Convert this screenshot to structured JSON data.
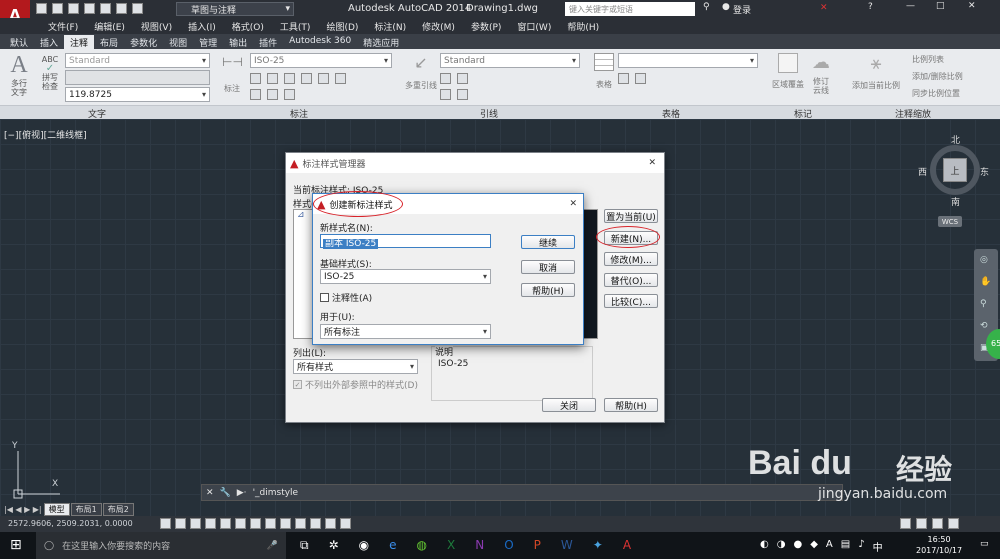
{
  "titlebar": {
    "workspace": "草图与注释",
    "app_title": "Autodesk AutoCAD 2014",
    "file": "Drawing1.dwg",
    "search_placeholder": "键入关键字或短语",
    "login": "登录"
  },
  "menu": [
    "文件(F)",
    "编辑(E)",
    "视图(V)",
    "插入(I)",
    "格式(O)",
    "工具(T)",
    "绘图(D)",
    "标注(N)",
    "修改(M)",
    "参数(P)",
    "窗口(W)",
    "帮助(H)"
  ],
  "ribbon_tabs": [
    "默认",
    "插入",
    "注释",
    "布局",
    "参数化",
    "视图",
    "管理",
    "输出",
    "插件",
    "Autodesk 360",
    "精选应用"
  ],
  "active_tab": "注释",
  "ribbon": {
    "text": {
      "multiline": "多行\n文字",
      "spell": "拼写\n检查",
      "style": "Standard",
      "height": "119.8725",
      "panel": "文字"
    },
    "dim": {
      "label": "标注",
      "style": "ISO-25",
      "panel": "标注"
    },
    "leader": {
      "label": "多重引线",
      "style": "Standard",
      "panel": "引线"
    },
    "table": {
      "label": "表格",
      "panel": "表格"
    },
    "markup": {
      "region": "区域覆盖",
      "revcloud": "修订\n云线",
      "panel": "标记"
    },
    "scale": {
      "add_current": "添加当前比例",
      "scale_list": "比例列表",
      "add_delete": "添加/删除比例",
      "sync": "同步比例位置",
      "panel": "注释缩放"
    }
  },
  "viewport_label": "[−][俯视][二维线框]",
  "viewcube": {
    "north": "北",
    "south": "南",
    "east": "东",
    "west": "西",
    "top": "上",
    "wcs": "WCS"
  },
  "ucs": {
    "x": "X",
    "y": "Y"
  },
  "cmdline": "'_dimstyle",
  "layout_tabs": [
    "模型",
    "布局1",
    "布局2"
  ],
  "coords": "2572.9606, 2509.2031, 0.0000",
  "dimstyle_dialog": {
    "title": "标注样式管理器",
    "current_label": "当前标注样式: ISO-25",
    "styles_label": "样式(S):",
    "list_label": "列出(L):",
    "list_value": "所有样式",
    "no_external": "不列出外部参照中的样式(D)",
    "desc_label": "说明",
    "desc_value": "ISO-25",
    "buttons": {
      "set_current": "置为当前(U)",
      "new": "新建(N)...",
      "modify": "修改(M)...",
      "override": "替代(O)...",
      "compare": "比较(C)...",
      "close": "关闭",
      "help": "帮助(H)"
    }
  },
  "new_dialog": {
    "title": "创建新标注样式",
    "name_label": "新样式名(N):",
    "name_value": "副本 ISO-25",
    "base_label": "基础样式(S):",
    "base_value": "ISO-25",
    "annotative": "注释性(A)",
    "use_label": "用于(U):",
    "use_value": "所有标注",
    "continue": "继续",
    "cancel": "取消",
    "help": "帮助(H)"
  },
  "taskbar": {
    "search": "在这里输入你要搜索的内容",
    "time": "16:50",
    "date": "2017/10/17"
  },
  "watermark": {
    "brand": "Bai du",
    "brand_cn": "经验",
    "url": "jingyan.baidu.com"
  },
  "colors": {
    "ellipse": "#d8232a",
    "accent": "#3b7dd8"
  }
}
